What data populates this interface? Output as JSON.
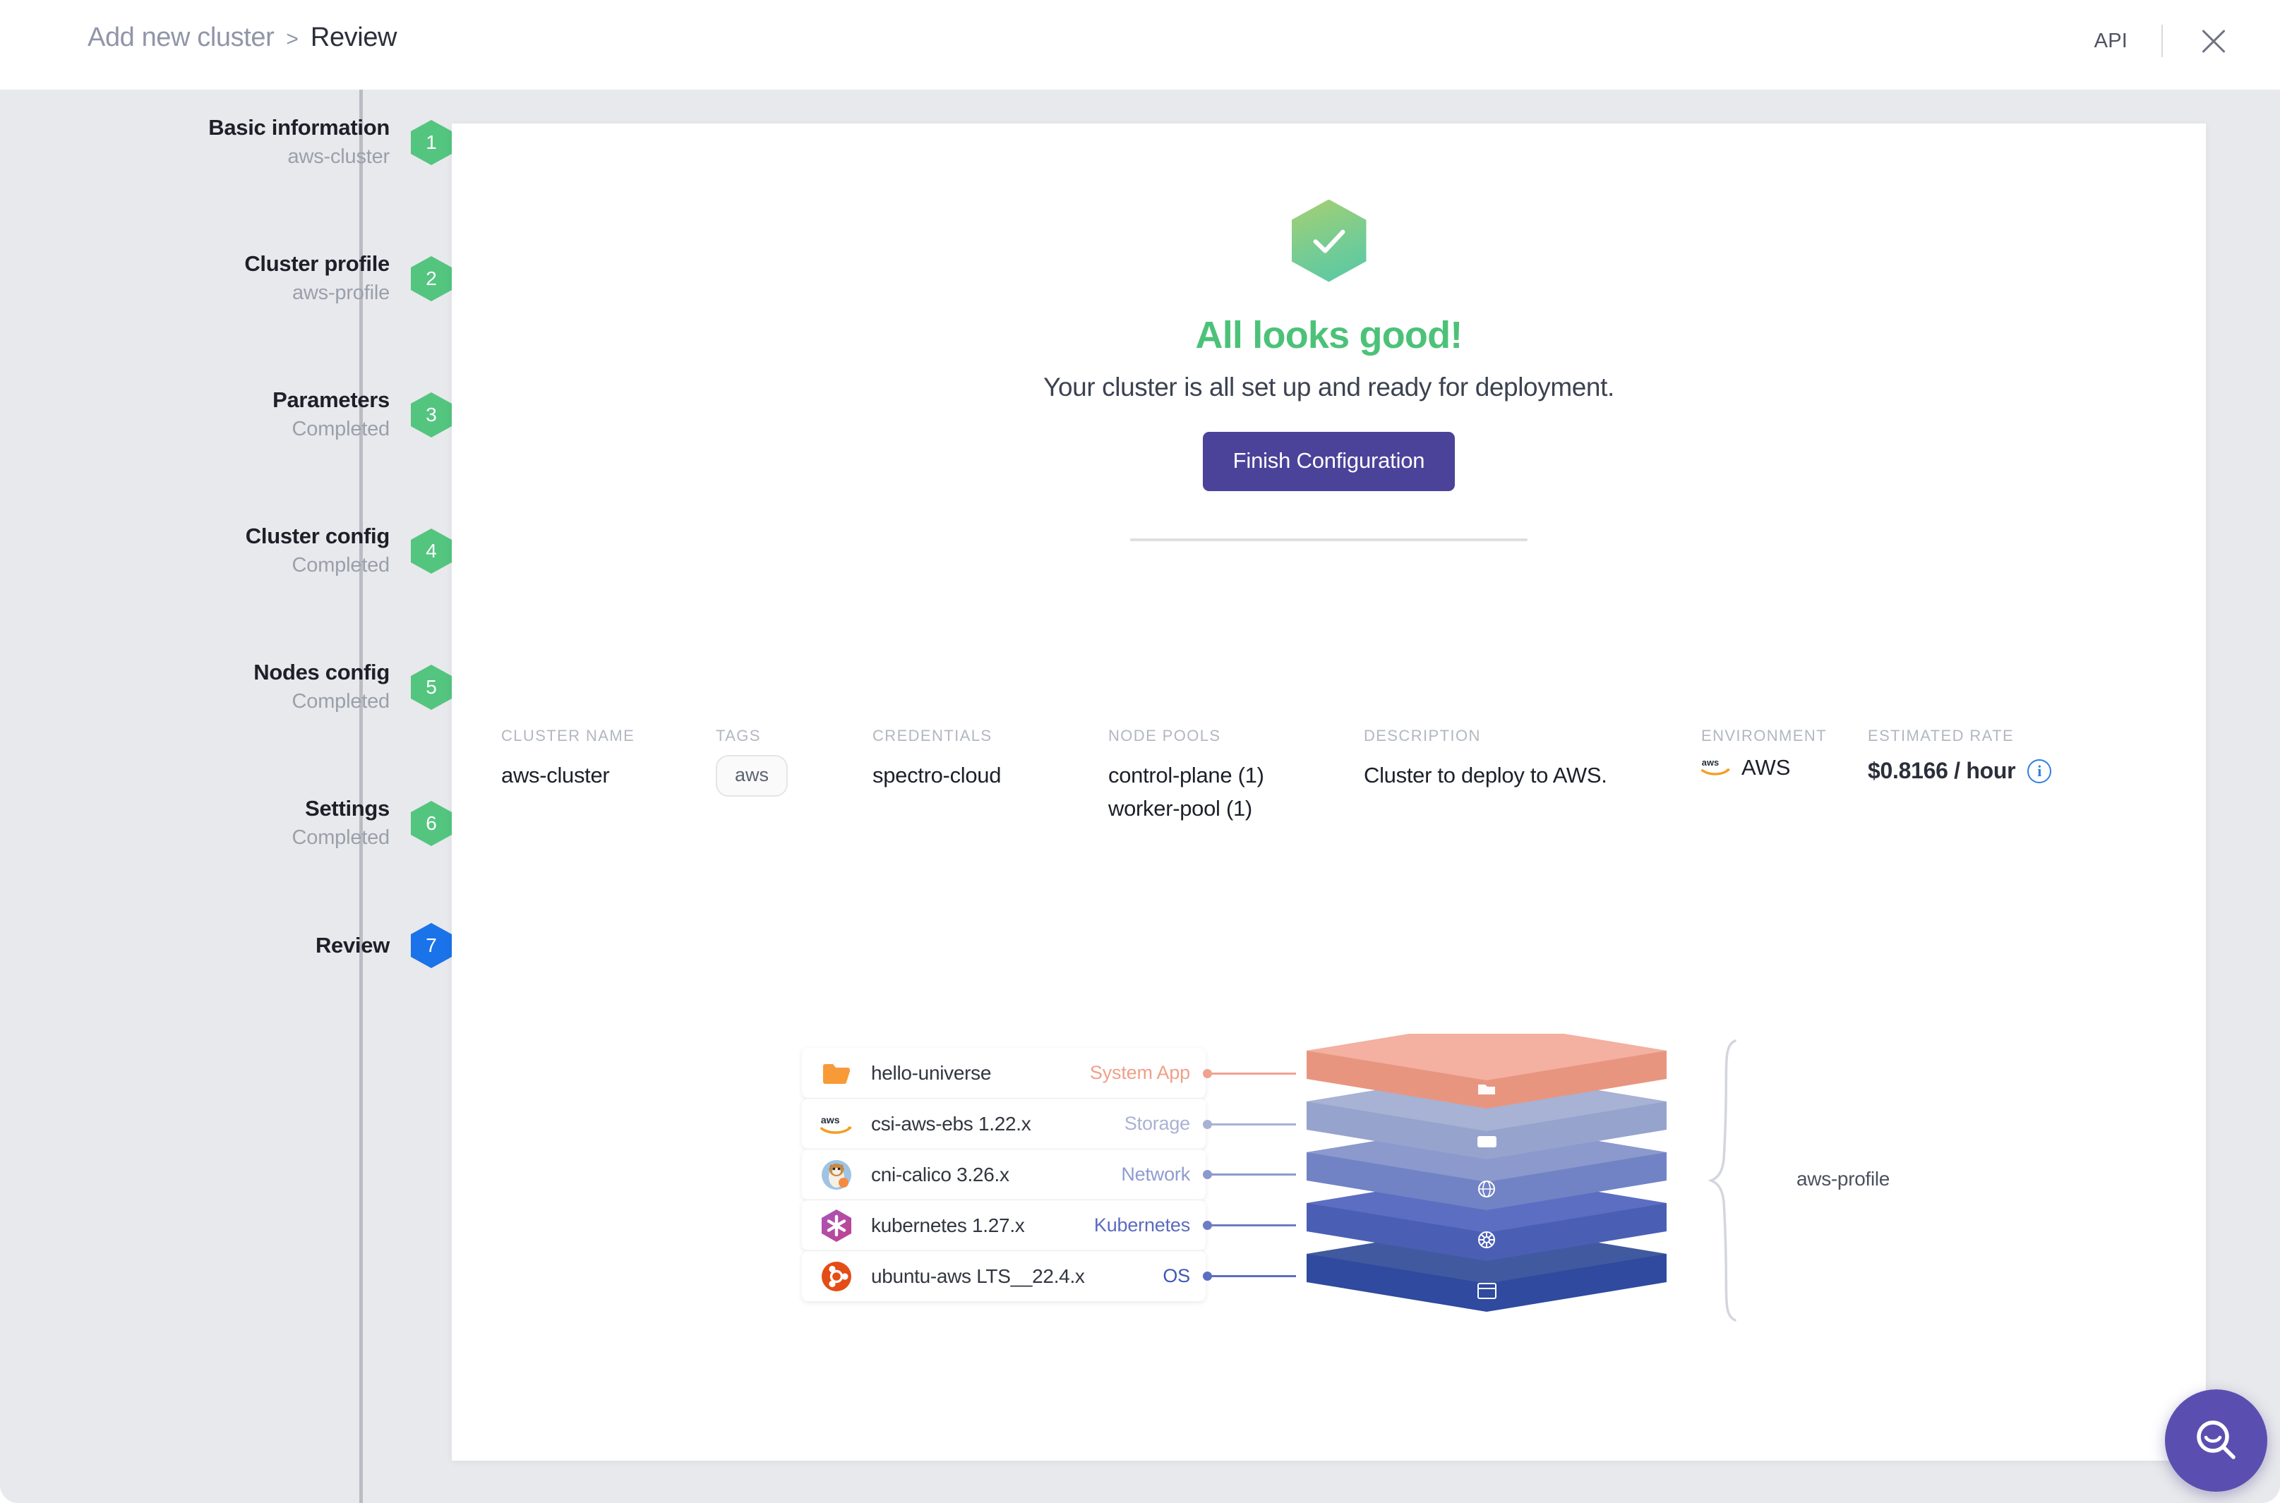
{
  "header": {
    "breadcrumb_root": "Add new cluster",
    "breadcrumb_sep": ">",
    "breadcrumb_current": "Review",
    "api_label": "API",
    "close_label": "Close"
  },
  "sidebar": {
    "steps": [
      {
        "num": "1",
        "title": "Basic information",
        "sub": "aws-cluster",
        "state": "done"
      },
      {
        "num": "2",
        "title": "Cluster profile",
        "sub": "aws-profile",
        "state": "done"
      },
      {
        "num": "3",
        "title": "Parameters",
        "sub": "Completed",
        "state": "done"
      },
      {
        "num": "4",
        "title": "Cluster config",
        "sub": "Completed",
        "state": "done"
      },
      {
        "num": "5",
        "title": "Nodes config",
        "sub": "Completed",
        "state": "done"
      },
      {
        "num": "6",
        "title": "Settings",
        "sub": "Completed",
        "state": "done"
      },
      {
        "num": "7",
        "title": "Review",
        "sub": "",
        "state": "current"
      }
    ],
    "done_color": "#53c57f",
    "current_color": "#1a73e8"
  },
  "hero": {
    "status_icon": "check-hexagon-icon",
    "title": "All looks good!",
    "subtitle": "Your cluster is all set up and ready for deployment.",
    "finish_button": "Finish Configuration",
    "title_color": "#4cc279",
    "button_color": "#4b4399"
  },
  "summary": {
    "cluster_name": {
      "label": "CLUSTER NAME",
      "value": "aws-cluster"
    },
    "tags": {
      "label": "TAGS",
      "values": [
        "aws"
      ]
    },
    "credentials": {
      "label": "CREDENTIALS",
      "value": "spectro-cloud"
    },
    "node_pools": {
      "label": "NODE POOLS",
      "values": [
        "control-plane (1)",
        "worker-pool (1)"
      ]
    },
    "description": {
      "label": "DESCRIPTION",
      "value": "Cluster to deploy to AWS."
    },
    "environment": {
      "label": "ENVIRONMENT",
      "value": "AWS",
      "icon": "aws-logo-icon"
    },
    "estimated_rate": {
      "label": "ESTIMATED RATE",
      "value": "$0.8166 / hour",
      "info_icon": "info-icon"
    }
  },
  "profile": {
    "name": "aws-profile",
    "layers": [
      {
        "icon": "folder-icon",
        "name": "hello-universe",
        "type": "System App",
        "type_color": "#f0a08a",
        "stack_color": "#f0a291"
      },
      {
        "icon": "aws-logo-icon",
        "name": "csi-aws-ebs 1.22.x",
        "type": "Storage",
        "type_color": "#aab2d4",
        "stack_color": "#a7b2d4"
      },
      {
        "icon": "calico-cat-icon",
        "name": "cni-calico 3.26.x",
        "type": "Network",
        "type_color": "#8e9cd0",
        "stack_color": "#8b99cd"
      },
      {
        "icon": "kubernetes-hex-icon",
        "name": "kubernetes 1.27.x",
        "type": "Kubernetes",
        "type_color": "#5b6bbf",
        "stack_color": "#5b6ec2"
      },
      {
        "icon": "ubuntu-icon",
        "name": "ubuntu-aws LTS__22.4.x",
        "type": "OS",
        "type_color": "#3f58b5",
        "stack_color": "#2f4a9e"
      }
    ],
    "stack_icons": [
      "folder-icon",
      "storage-icon",
      "globe-icon",
      "kubernetes-helm-icon",
      "os-window-icon"
    ]
  },
  "fab": {
    "icon": "search-smile-icon",
    "color": "#5a4fb0"
  }
}
